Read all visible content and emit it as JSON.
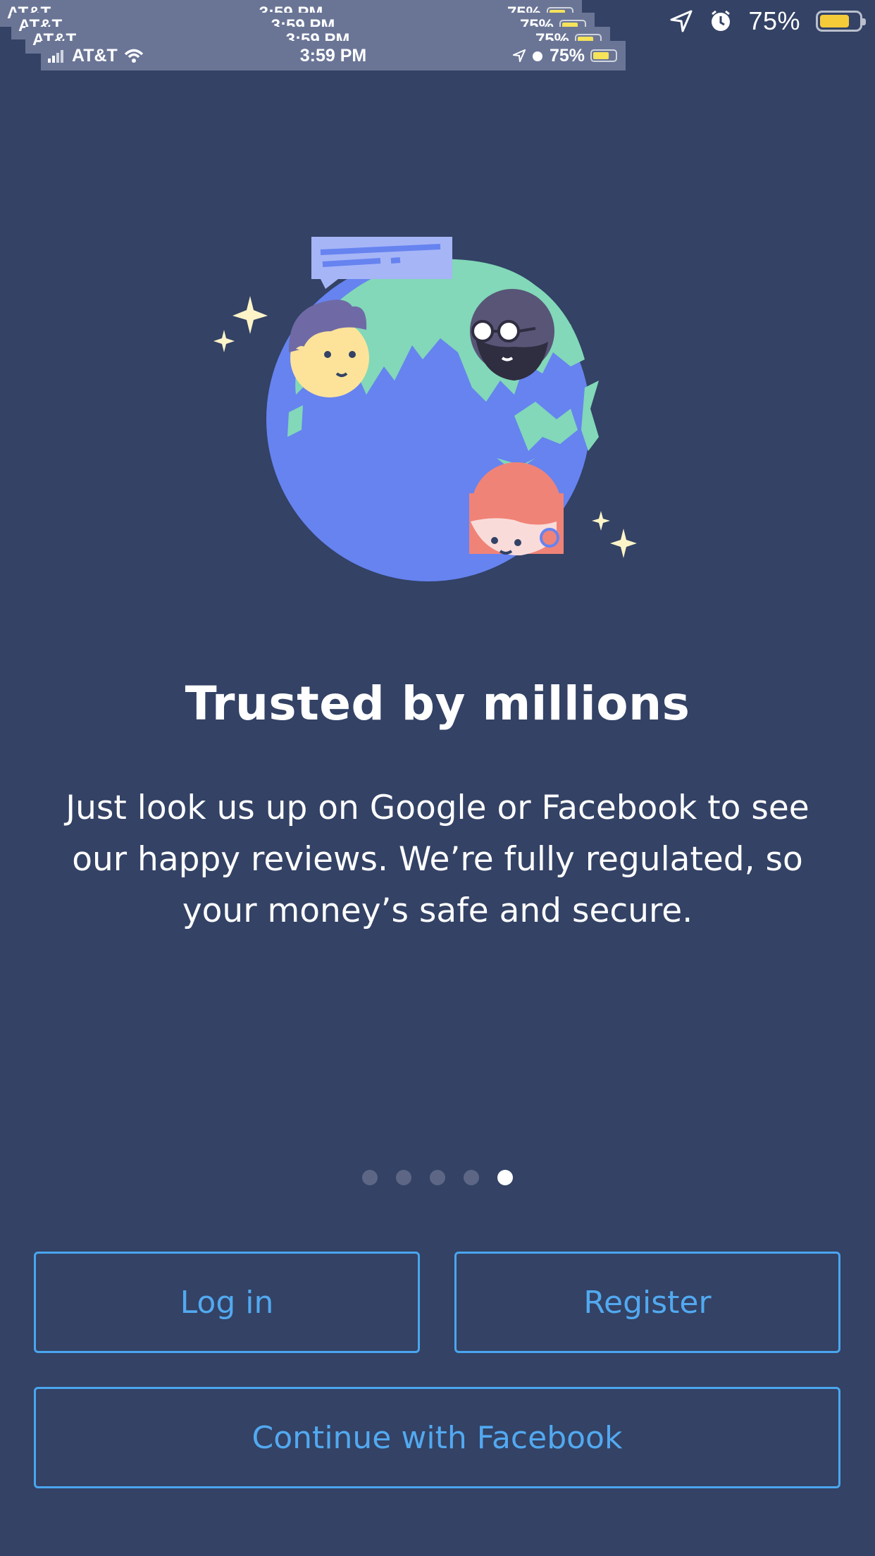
{
  "status_bar": {
    "battery_pct": "75%",
    "battery_level": 0.75,
    "icons": [
      "location-arrow-icon",
      "alarm-icon",
      "battery-icon"
    ]
  },
  "ghost_status_bar": {
    "carrier": "AT&T",
    "time": "3:59 PM",
    "battery_pct": "75%"
  },
  "onboarding": {
    "title": "Trusted by millions",
    "body_lines": [
      "Just look us up on Google or Facebook to see",
      "our happy reviews. We’re fully regulated, so",
      "your money’s safe and secure."
    ],
    "page_count": 5,
    "active_page": 5
  },
  "actions": {
    "login_label": "Log in",
    "register_label": "Register",
    "facebook_label": "Continue with Facebook"
  },
  "colors": {
    "background": "#334265",
    "accent": "#4aa6ef",
    "globe_ocean": "#6683f0",
    "globe_land": "#82d8b8",
    "sparkle": "#fdf4c8"
  }
}
